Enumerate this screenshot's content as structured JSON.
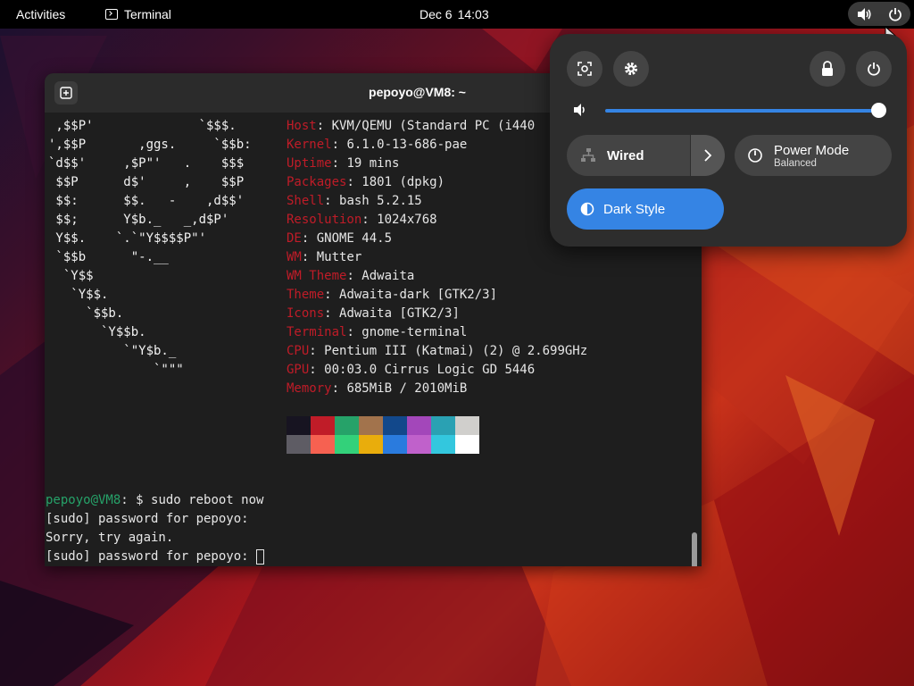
{
  "topbar": {
    "activities": "Activities",
    "app_name": "Terminal",
    "date": "Dec 6",
    "time": "14:03"
  },
  "terminal": {
    "title": "pepoyo@VM8: ~",
    "ascii_art": [
      " ,$$P'              `$$$.",
      "',$$P       ,ggs.     `$$b:",
      "`d$$'     ,$P\"'   .    $$$",
      " $$P      d$'     ,    $$P",
      " $$:      $$.   -    ,d$$'",
      " $$;      Y$b._   _,d$P'",
      " Y$$.    `.`\"Y$$$$P\"'",
      " `$$b      \"-.__",
      "  `Y$$",
      "   `Y$$.",
      "     `$$b.",
      "       `Y$$b.",
      "          `\"Y$b._",
      "              `\"\"\""
    ],
    "info": [
      {
        "key": "Host",
        "value": "KVM/QEMU (Standard PC (i440"
      },
      {
        "key": "Kernel",
        "value": "6.1.0-13-686-pae"
      },
      {
        "key": "Uptime",
        "value": "19 mins"
      },
      {
        "key": "Packages",
        "value": "1801 (dpkg)"
      },
      {
        "key": "Shell",
        "value": "bash 5.2.15"
      },
      {
        "key": "Resolution",
        "value": "1024x768"
      },
      {
        "key": "DE",
        "value": "GNOME 44.5"
      },
      {
        "key": "WM",
        "value": "Mutter"
      },
      {
        "key": "WM Theme",
        "value": "Adwaita"
      },
      {
        "key": "Theme",
        "value": "Adwaita-dark [GTK2/3]"
      },
      {
        "key": "Icons",
        "value": "Adwaita [GTK2/3]"
      },
      {
        "key": "Terminal",
        "value": "gnome-terminal"
      },
      {
        "key": "CPU",
        "value": "Pentium III (Katmai) (2) @ 2.699GHz"
      },
      {
        "key": "GPU",
        "value": "00:03.0 Cirrus Logic GD 5446"
      },
      {
        "key": "Memory",
        "value": "685MiB / 2010MiB"
      }
    ],
    "palette_top": [
      "#171421",
      "#c01c28",
      "#26a269",
      "#a2734c",
      "#12488b",
      "#a347ba",
      "#2aa1b3",
      "#d0cfcc"
    ],
    "palette_bottom": [
      "#5e5c64",
      "#f66151",
      "#33d17a",
      "#e9ad0c",
      "#2a7bde",
      "#c061cb",
      "#33c7de",
      "#ffffff"
    ],
    "prompt_user": "pepoyo@VM8",
    "prompt_rest": ": $ sudo reboot now",
    "line_sudo_1": "[sudo] password for pepoyo:",
    "line_sorry": "Sorry, try again.",
    "line_sudo_2": "[sudo] password for pepoyo: "
  },
  "quick_settings": {
    "volume_percent": 100,
    "wired_label": "Wired",
    "power_mode_label": "Power Mode",
    "power_mode_value": "Balanced",
    "dark_style_label": "Dark Style",
    "accent_color": "#3584e4"
  }
}
